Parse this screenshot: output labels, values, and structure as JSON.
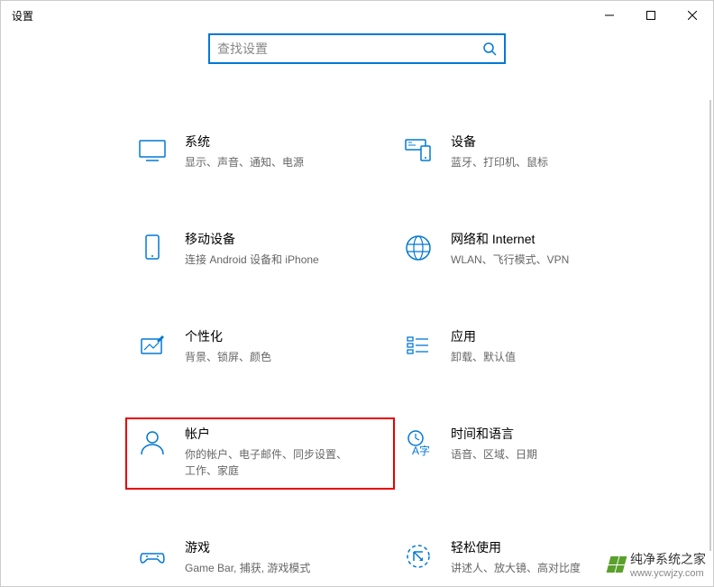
{
  "window": {
    "title": "设置"
  },
  "search": {
    "placeholder": "查找设置"
  },
  "categories": [
    {
      "title": "系统",
      "subtitle": "显示、声音、通知、电源"
    },
    {
      "title": "设备",
      "subtitle": "蓝牙、打印机、鼠标"
    },
    {
      "title": "移动设备",
      "subtitle": "连接 Android 设备和 iPhone"
    },
    {
      "title": "网络和 Internet",
      "subtitle": "WLAN、飞行模式、VPN"
    },
    {
      "title": "个性化",
      "subtitle": "背景、锁屏、颜色"
    },
    {
      "title": "应用",
      "subtitle": "卸载、默认值"
    },
    {
      "title": "帐户",
      "subtitle": "你的帐户、电子邮件、同步设置、工作、家庭"
    },
    {
      "title": "时间和语言",
      "subtitle": "语音、区域、日期"
    },
    {
      "title": "游戏",
      "subtitle": "Game Bar, 捕获, 游戏模式"
    },
    {
      "title": "轻松使用",
      "subtitle": "讲述人、放大镜、高对比度"
    }
  ],
  "watermark": {
    "text": "纯净系统之家",
    "url": "www.ycwjzy.com"
  }
}
